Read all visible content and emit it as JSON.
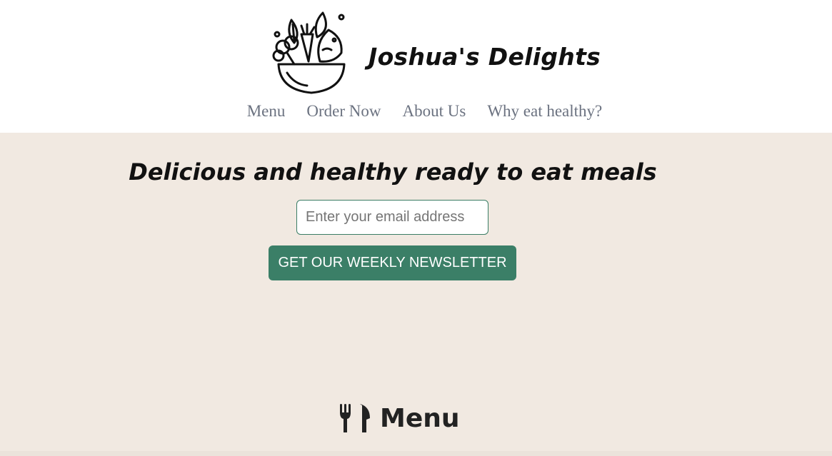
{
  "brand": {
    "name": "Joshua's Delights",
    "logo_icon": "salad-bowl-icon"
  },
  "nav": {
    "items": [
      {
        "label": "Menu"
      },
      {
        "label": "Order Now"
      },
      {
        "label": "About Us"
      },
      {
        "label": "Why eat healthy?"
      }
    ]
  },
  "hero": {
    "title": "Delicious and healthy ready to eat meals",
    "email_placeholder": "Enter your email address",
    "cta_label": "GET OUR WEEKLY NEWSLETTER"
  },
  "menu_section": {
    "icon": "utensils-icon",
    "title": "Menu"
  },
  "colors": {
    "hero_background": "#f1e9e1",
    "accent_green": "#3b7f67",
    "nav_text": "#6b7280"
  }
}
